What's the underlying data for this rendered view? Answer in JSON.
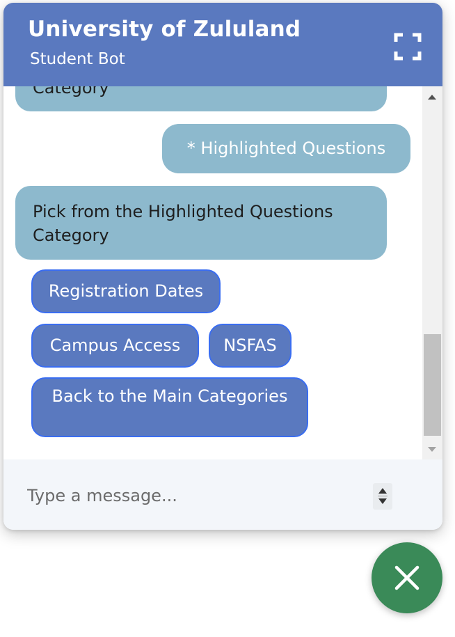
{
  "header": {
    "title": "University of Zululand",
    "subtitle": "Student Bot",
    "fullscreen_icon": "fullscreen-icon"
  },
  "messages": {
    "partial_bot_text": "Category",
    "user_message": "* Highlighted Questions",
    "bot_message": "Pick from the Highlighted Questions Category"
  },
  "options": {
    "registration_dates": "Registration Dates",
    "campus_access": "Campus Access",
    "nsfas": "NSFAS",
    "back_to_main": "Back to the Main Categories"
  },
  "input": {
    "placeholder": "Type a message..."
  },
  "colors": {
    "header_bg": "#5a79bf",
    "bubble_bg": "#8db9cd",
    "option_bg": "#5a79bf",
    "option_border": "#3a6df0",
    "close_button_bg": "#3a8a58",
    "input_bar_bg": "#f3f6fa"
  },
  "close_button": {
    "icon": "close-icon"
  }
}
